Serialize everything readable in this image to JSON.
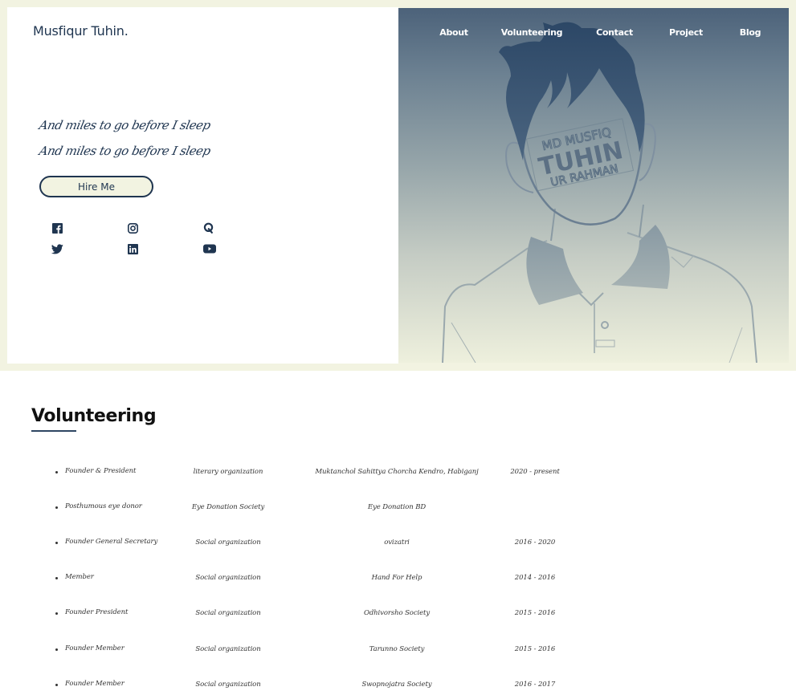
{
  "brand": {
    "name": "Musfiqur Tuhin."
  },
  "nav": {
    "items": [
      {
        "label": "About"
      },
      {
        "label": "Volunteering"
      },
      {
        "label": "Contact"
      },
      {
        "label": "Project"
      },
      {
        "label": "Blog"
      }
    ]
  },
  "hero": {
    "tagline_lines": [
      "And miles to go before I sleep",
      "And miles to go before I sleep"
    ],
    "hire_button_label": "Hire Me",
    "portrait_watermark": [
      "MD MUSFIQ",
      "TUHIN",
      "UR RAHMAN"
    ],
    "social_links": [
      {
        "icon": "facebook-icon"
      },
      {
        "icon": "instagram-icon"
      },
      {
        "icon": "quora-icon"
      },
      {
        "icon": "twitter-icon"
      },
      {
        "icon": "linkedin-icon"
      },
      {
        "icon": "youtube-icon"
      }
    ]
  },
  "volunteering": {
    "title": "Volunteering",
    "rows": [
      {
        "role": "Founder & President",
        "type": "literary organization",
        "organization": "Muktanchol Sahittya Chorcha Kendro, Habiganj",
        "period": "2020 - present"
      },
      {
        "role": "Posthumous eye donor",
        "type": "Eye Donation Society",
        "organization": "Eye Donation BD",
        "period": ""
      },
      {
        "role": "Founder General Secretary",
        "type": "Social organization",
        "organization": "ovizatri",
        "period": "2016 - 2020"
      },
      {
        "role": "Member",
        "type": "Social organization",
        "organization": "Hand For Help",
        "period": "2014 - 2016"
      },
      {
        "role": "Founder President",
        "type": "Social organization",
        "organization": "Odhivorsho Society",
        "period": "2015 - 2016"
      },
      {
        "role": "Founder Member",
        "type": "Social organization",
        "organization": "Tarunno Society",
        "period": "2015 - 2016"
      },
      {
        "role": "Founder Member",
        "type": "Social organization",
        "organization": "Swopnojatra Society",
        "period": "2016 - 2017"
      }
    ]
  },
  "colors": {
    "frame_bg": "#f2f3e1",
    "primary_navy": "#1f3550",
    "nav_text": "#ffffff",
    "gradient_top": "#4c627a",
    "gradient_bottom": "#eef0dd"
  }
}
